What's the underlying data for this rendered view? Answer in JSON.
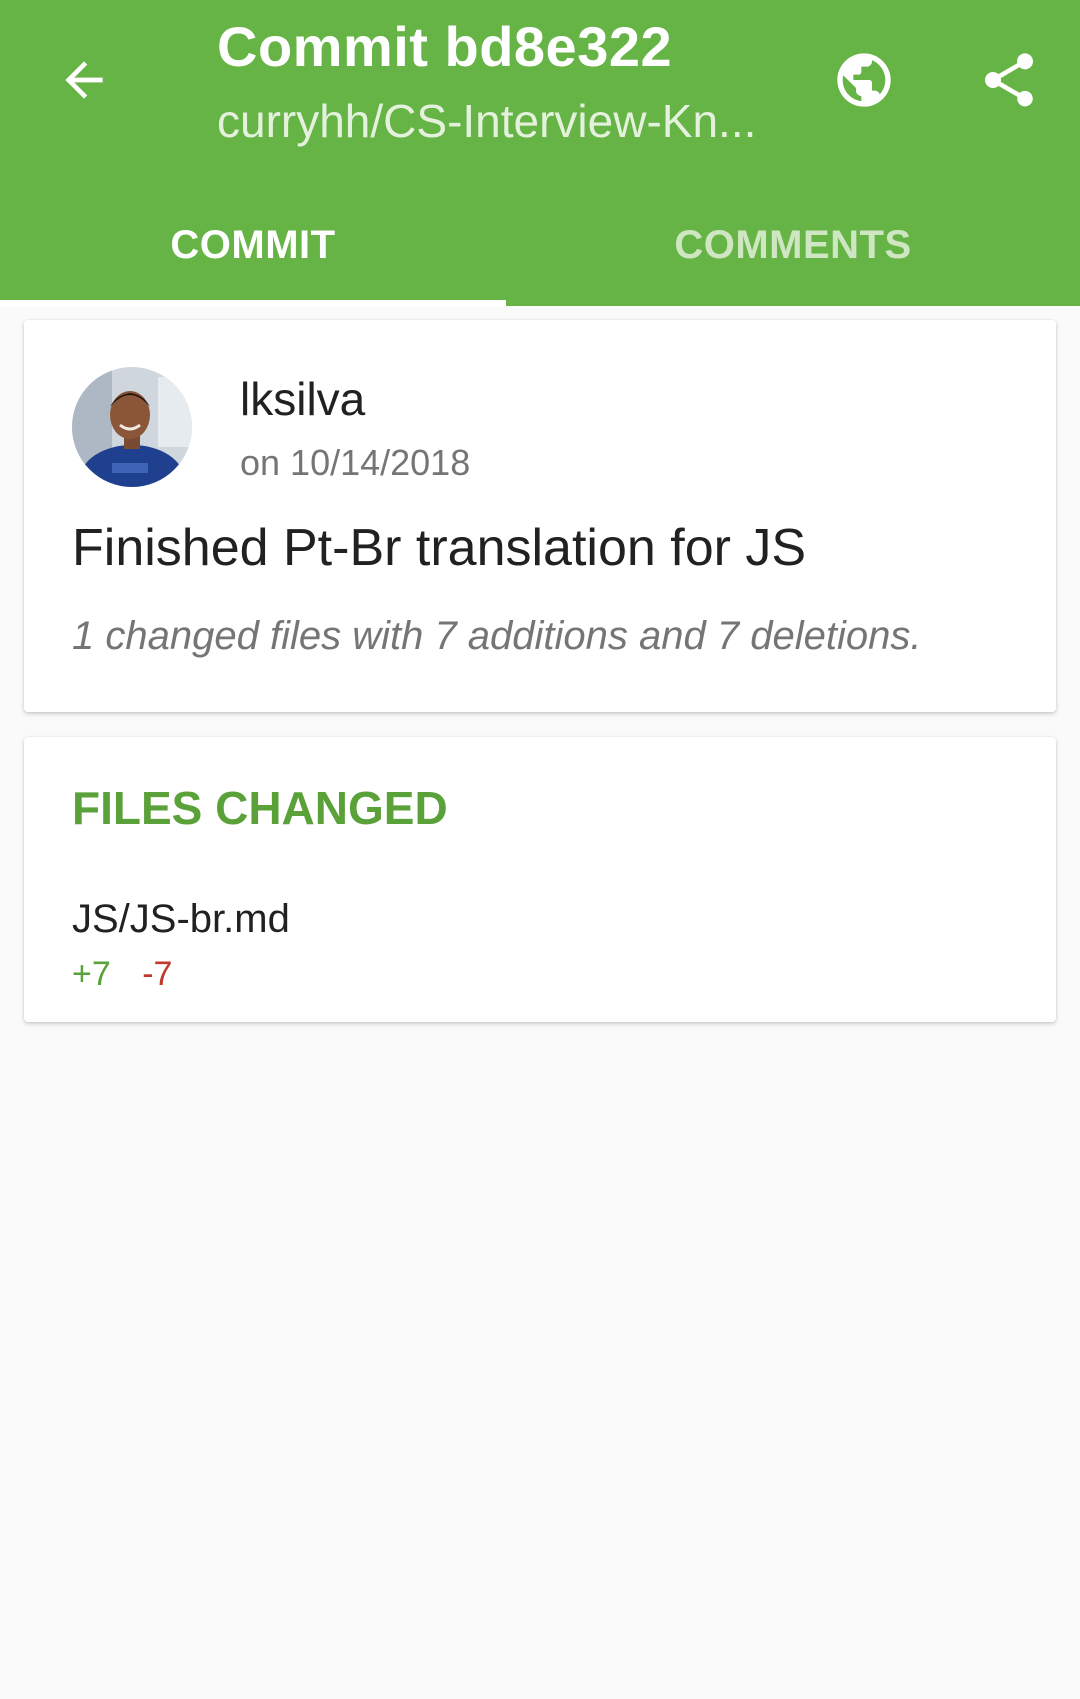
{
  "appbar": {
    "title": "Commit bd8e322",
    "subtitle": "curryhh/CS-Interview-Kn...",
    "back_icon": "arrow-back-icon",
    "browser_icon": "globe-icon",
    "share_icon": "share-icon"
  },
  "tabs": [
    {
      "label": "COMMIT",
      "selected": true
    },
    {
      "label": "COMMENTS",
      "selected": false
    }
  ],
  "commit": {
    "author": "lksilva",
    "date": "on 10/14/2018",
    "message": "Finished Pt-Br translation for JS",
    "summary": "1 changed files with 7 additions and 7 deletions."
  },
  "files": {
    "title": "FILES CHANGED",
    "items": [
      {
        "name": "JS/JS-br.md",
        "additions": "+7",
        "deletions": "-7"
      }
    ]
  },
  "colors": {
    "primary": "#66b346",
    "accent_text": "#5aa13a",
    "deletion": "#c0392b"
  }
}
